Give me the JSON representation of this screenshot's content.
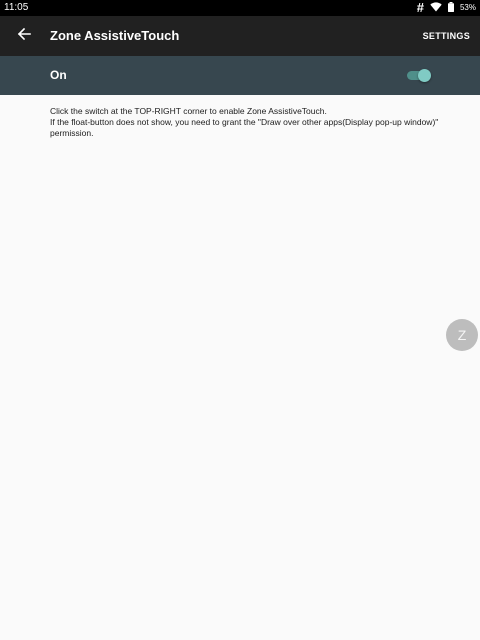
{
  "status_bar": {
    "time": "11:05",
    "hash_symbol": "#",
    "battery_percent": "53%",
    "icons": [
      "wifi-icon",
      "battery-icon"
    ]
  },
  "app_bar": {
    "title": "Zone AssistiveTouch",
    "settings_label": "SETTINGS",
    "back_icon": "arrow-back-icon"
  },
  "switch_bar": {
    "label": "On",
    "checked": true,
    "accent_color": "#80cbc4"
  },
  "instructions": {
    "line1": "Click the switch at the TOP-RIGHT corner to enable Zone AssistiveTouch.",
    "line2": "If the float-button does not show, you need to grant the \"Draw over other apps(Display pop-up window)\" permission."
  },
  "float_button": {
    "label": "Z"
  },
  "colors": {
    "status_bar": "#000000",
    "app_bar": "#212121",
    "switch_bar": "#37474f",
    "background": "#fafafa"
  }
}
